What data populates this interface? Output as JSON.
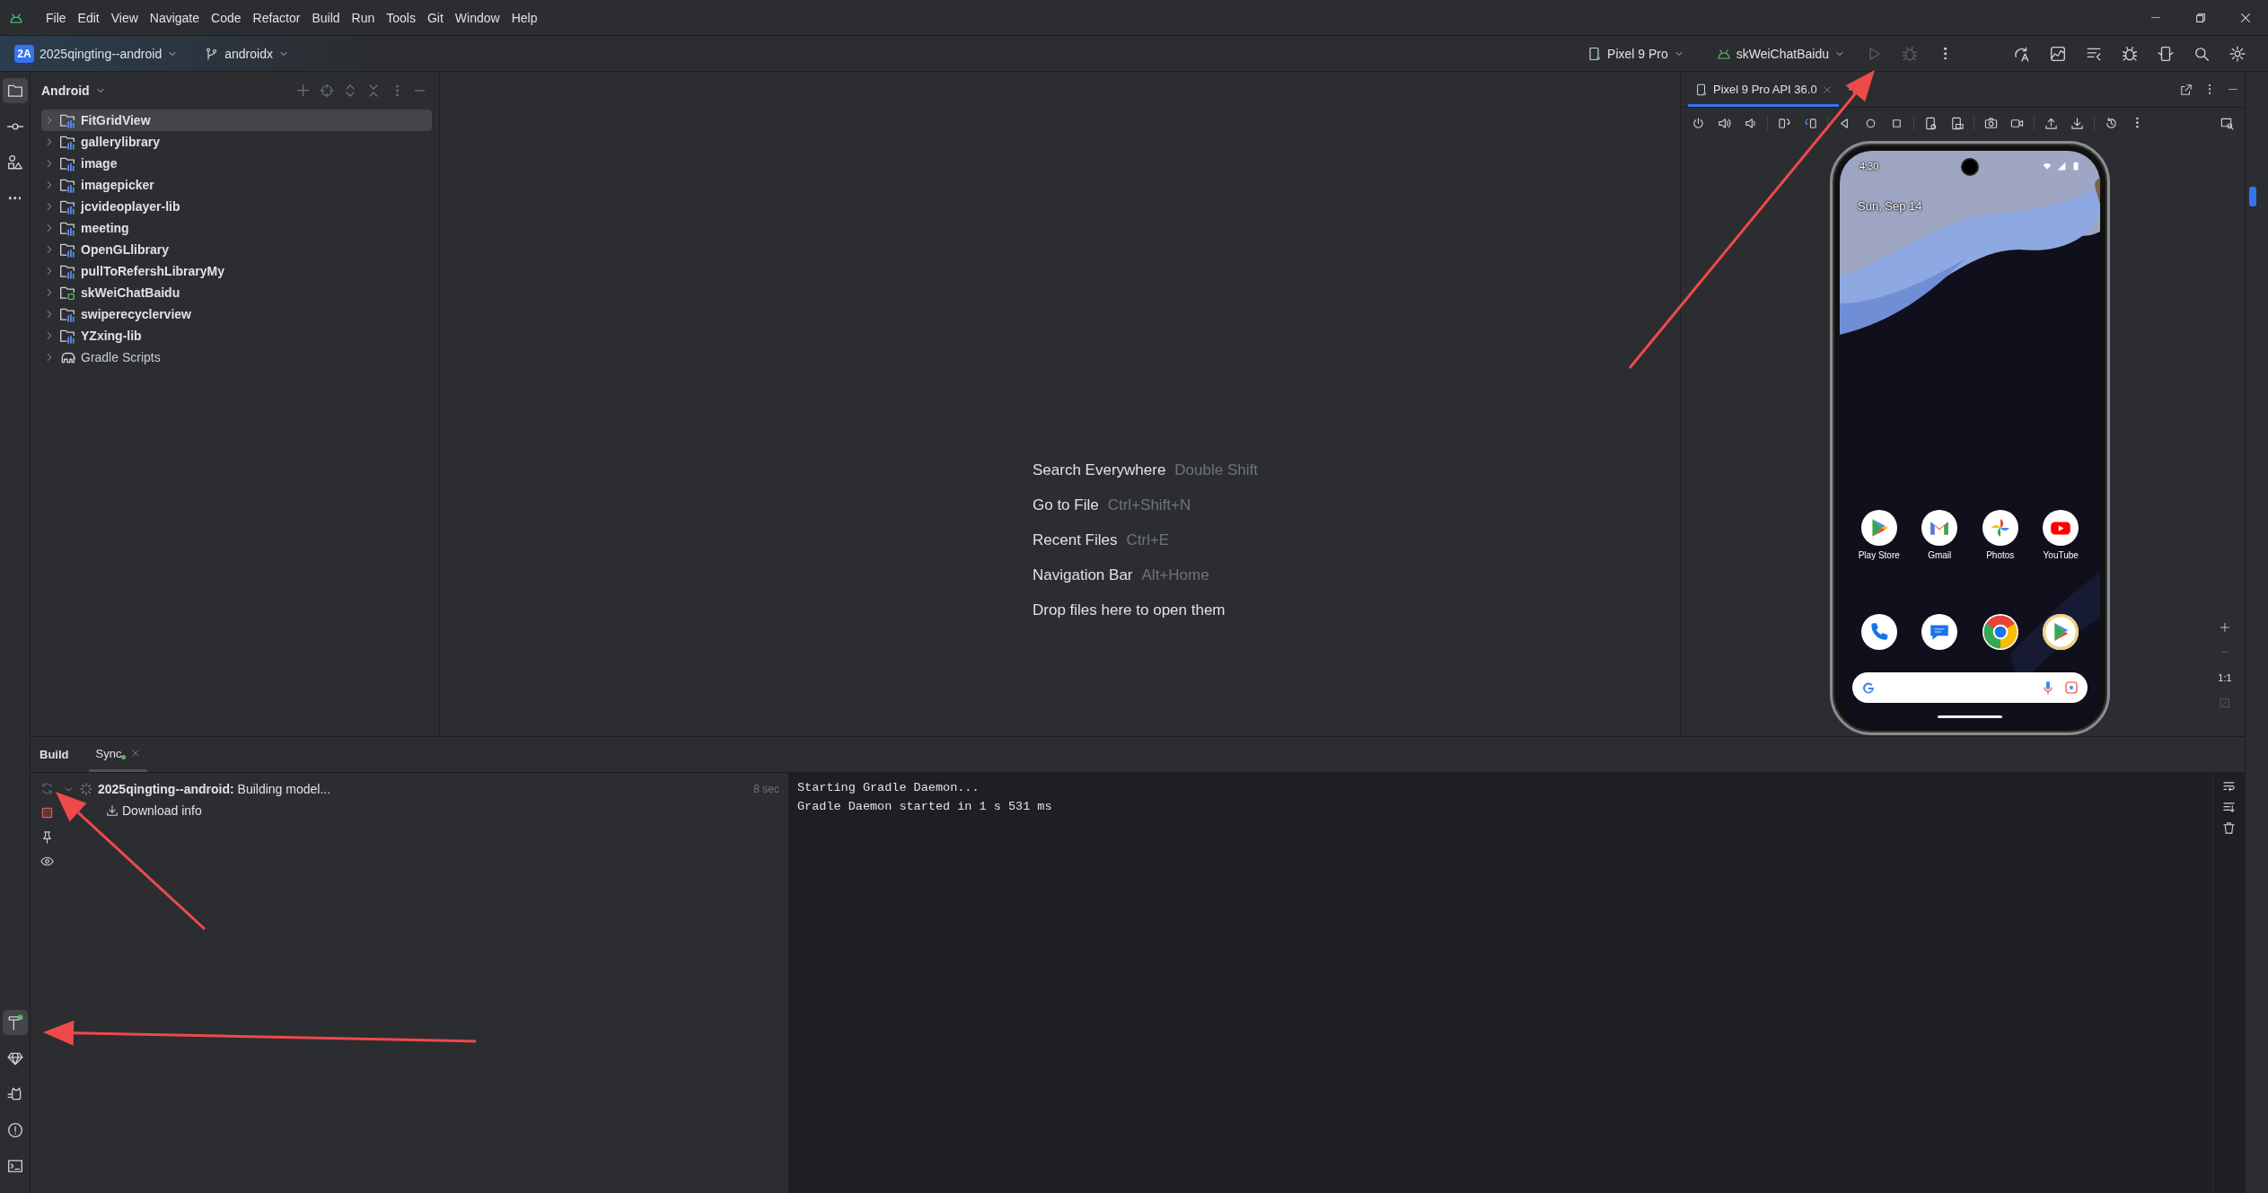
{
  "menu_bar": {
    "items": [
      "File",
      "Edit",
      "View",
      "Navigate",
      "Code",
      "Refactor",
      "Build",
      "Run",
      "Tools",
      "Git",
      "Window",
      "Help"
    ]
  },
  "toolbar": {
    "project_badge": "2A",
    "project": "2025qingting--android",
    "branch": "androidx",
    "device": "Pixel 9 Pro",
    "run_config": "skWeiChatBaidu"
  },
  "project_panel": {
    "title": "Android",
    "items": [
      {
        "label": "FitGridView",
        "kind": "module",
        "selected": true
      },
      {
        "label": "gallerylibrary",
        "kind": "module",
        "selected": false
      },
      {
        "label": "image",
        "kind": "module",
        "selected": false
      },
      {
        "label": "imagepicker",
        "kind": "module",
        "selected": false
      },
      {
        "label": "jcvideoplayer-lib",
        "kind": "module",
        "selected": false
      },
      {
        "label": "meeting",
        "kind": "module",
        "selected": false
      },
      {
        "label": "OpenGLlibrary",
        "kind": "module",
        "selected": false
      },
      {
        "label": "pullToRefershLibraryMy",
        "kind": "module",
        "selected": false
      },
      {
        "label": "skWeiChatBaidu",
        "kind": "app",
        "selected": false
      },
      {
        "label": "swiperecyclerview",
        "kind": "module",
        "selected": false
      },
      {
        "label": "YZxing-lib",
        "kind": "module",
        "selected": false
      },
      {
        "label": "Gradle Scripts",
        "kind": "gradle",
        "selected": false
      }
    ]
  },
  "editor_hints": [
    {
      "action": "Search Everywhere",
      "shortcut": "Double Shift"
    },
    {
      "action": "Go to File",
      "shortcut": "Ctrl+Shift+N"
    },
    {
      "action": "Recent Files",
      "shortcut": "Ctrl+E"
    },
    {
      "action": "Navigation Bar",
      "shortcut": "Alt+Home"
    },
    {
      "action": "Drop files here to open them"
    }
  ],
  "running_devices": {
    "tab": "Pixel 9 Pro API 36.0",
    "zoom_label": "1:1",
    "phone": {
      "time": "4:30",
      "date": "Sun, Sep 14",
      "apps": [
        {
          "label": "Play Store",
          "kind": "play"
        },
        {
          "label": "Gmail",
          "kind": "gmail"
        },
        {
          "label": "Photos",
          "kind": "photos"
        },
        {
          "label": "YouTube",
          "kind": "youtube"
        }
      ],
      "dock": [
        {
          "kind": "phone"
        },
        {
          "kind": "messages"
        },
        {
          "kind": "chrome"
        },
        {
          "kind": "play_ring"
        }
      ]
    }
  },
  "build_panel": {
    "title": "Build",
    "tabs": [
      {
        "label": "Sync",
        "selected": true
      }
    ],
    "tree": {
      "text": "**2025qingting--android:** Building model...",
      "time": "8 sec",
      "expanded": true,
      "children": [
        {
          "label": "Download info"
        }
      ]
    },
    "console": [
      "Starting Gradle Daemon...",
      "Gradle Daemon started in 1 s 531 ms"
    ]
  }
}
